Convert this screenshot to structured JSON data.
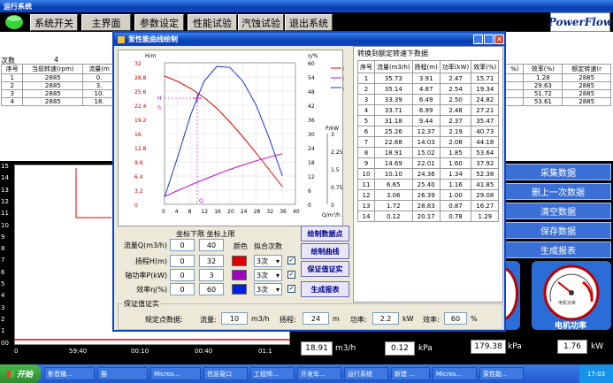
{
  "app": {
    "title": "运行系统",
    "logo": "PowerFlow"
  },
  "menu": [
    "系统开关",
    "主界面",
    "参数设定",
    "性能试验",
    "汽蚀试验",
    "退出系统"
  ],
  "bg_table": {
    "count_label": "次数",
    "count_value": "4",
    "headers": [
      "序号",
      "当前转速(rpm)",
      "流量(m"
    ],
    "rows": [
      [
        "1",
        "2885",
        "0."
      ],
      [
        "2",
        "2885",
        "3."
      ],
      [
        "3",
        "2885",
        "10."
      ],
      [
        "4",
        "2885",
        "18."
      ]
    ]
  },
  "right_table": {
    "top_label": "采集数据",
    "headers": [
      "%)",
      "效率(%)",
      "额定转速(r"
    ],
    "rows": [
      [
        "",
        "1.28",
        "2885"
      ],
      [
        "",
        "29.63",
        "2885"
      ],
      [
        "",
        "51.72",
        "2885"
      ],
      [
        "",
        "53.61",
        "2885"
      ]
    ]
  },
  "right_buttons": [
    "采集数据",
    "删上一次数据",
    "清空数据",
    "保存数据",
    "生成报表"
  ],
  "timeline": {
    "yticks": [
      "15",
      "14",
      "13",
      "12",
      "11",
      "10",
      "9",
      "8",
      "7",
      "6",
      "5",
      "4",
      "3",
      "2",
      "1",
      "00"
    ],
    "xticks": [
      "0",
      "59:40",
      "00:10",
      "00:40",
      "01:1"
    ]
  },
  "gauges": {
    "right_label": "电机功率",
    "right_sub": "电机功率"
  },
  "bottom_readouts": [
    {
      "value": "18.91",
      "unit": "m3/h"
    },
    {
      "value": "0.12",
      "unit": "kPa"
    },
    {
      "value": "179.38",
      "unit": "kPa"
    },
    {
      "value": "1.76",
      "unit": "kW"
    }
  ],
  "dialog": {
    "title": "泵性能曲线绘制",
    "axes": {
      "left_label": "H/m",
      "left_ticks": [
        "32",
        "28.8",
        "25.6",
        "22.4",
        "19.2",
        "16",
        "12.8",
        "9.6",
        "6.4",
        "3.2",
        "0"
      ],
      "mid_label": "η/%",
      "mid_ticks": [
        "60",
        "54",
        "48",
        "42",
        "36",
        "30",
        "24",
        "18",
        "12",
        "6",
        "0"
      ],
      "right_label": "P/kW",
      "right_ticks": [
        "3",
        "2.25",
        "1.5",
        "0.75",
        "0"
      ],
      "x_ticks": [
        "0",
        "4",
        "8",
        "12",
        "16",
        "20",
        "24",
        "28",
        "32",
        "36",
        "40"
      ],
      "x_label": "Q/m³/h",
      "h_marker": "H",
      "eta_marker": "η",
      "q_marker": "Q"
    },
    "legend": [
      "H-Q",
      "P-Q",
      "η-Q"
    ],
    "table_title": "转换到额定转速下数据",
    "table_headers": [
      "序号",
      "流量(m3/h)",
      "扬程(m)",
      "功率(kW)",
      "效率(%)"
    ],
    "table_rows": [
      [
        "1",
        "35.73",
        "3.91",
        "2.47",
        "15.71"
      ],
      [
        "2",
        "35.14",
        "4.87",
        "2.54",
        "19.34"
      ],
      [
        "3",
        "33.39",
        "6.49",
        "2.50",
        "24.82"
      ],
      [
        "4",
        "33.71",
        "6.99",
        "2.48",
        "27.21"
      ],
      [
        "5",
        "31.18",
        "9.44",
        "2.37",
        "35.47"
      ],
      [
        "6",
        "25.26",
        "12.37",
        "2.19",
        "40.73"
      ],
      [
        "7",
        "22.68",
        "14.03",
        "2.08",
        "44.18"
      ],
      [
        "8",
        "18.91",
        "15.02",
        "1.85",
        "53.64"
      ],
      [
        "9",
        "14.69",
        "22.01",
        "1.60",
        "37.92"
      ],
      [
        "10",
        "10.10",
        "24.36",
        "1.34",
        "52.38"
      ],
      [
        "11",
        "6.65",
        "25.40",
        "1.16",
        "41.85"
      ],
      [
        "12",
        "3.06",
        "26.39",
        "1.00",
        "29.08"
      ],
      [
        "13",
        "1.72",
        "28.83",
        "0.87",
        "16.27"
      ],
      [
        "14",
        "0.12",
        "20.17",
        "0.78",
        "1.29"
      ]
    ],
    "settings": {
      "header": "坐标下限 坐标上限",
      "rows": [
        {
          "label": "流量Q(m3/h)",
          "low": "0",
          "high": "40"
        },
        {
          "label": "扬程H(m)",
          "low": "0",
          "high": "32",
          "color": "#e00000",
          "fit": "3次"
        },
        {
          "label": "轴功率P(kW)",
          "low": "0",
          "high": "3",
          "color": "#a000c0",
          "fit": "3次"
        },
        {
          "label": "效率η(%)",
          "low": "0",
          "high": "60",
          "color": "#0020e0",
          "fit": "3次"
        }
      ],
      "color_label": "颜色",
      "fit_label": "拟合次数"
    },
    "actions": [
      "绘制数据点",
      "绘制曲线",
      "保证值证实",
      "生成报表"
    ],
    "guarantee": {
      "group": "保证值证实",
      "label": "规定点数据:",
      "flow_label": "流量:",
      "flow": "10",
      "flow_unit": "m3/h",
      "head_label": "扬程:",
      "head": "24",
      "head_unit": "m",
      "power_label": "功率:",
      "power": "2.2",
      "power_unit": "kW",
      "eff_label": "效率:",
      "eff": "60",
      "eff_unit": "%"
    }
  },
  "chart_data": {
    "type": "line",
    "title": "",
    "xlabel": "Q/m³/h",
    "xlim": [
      0,
      40
    ],
    "series": [
      {
        "name": "H-Q",
        "axis": "H",
        "ylim": [
          0,
          32
        ],
        "color": "#e00000",
        "x": [
          0,
          4,
          8,
          12,
          16,
          20,
          24,
          28,
          32,
          36
        ],
        "values": [
          29,
          27.8,
          26.2,
          24.2,
          21.7,
          18.6,
          15.2,
          11.6,
          7.8,
          4.0
        ]
      },
      {
        "name": "P-Q",
        "axis": "P",
        "ylim": [
          0,
          3
        ],
        "color": "#d000d0",
        "x": [
          0,
          4,
          8,
          12,
          16,
          20,
          24,
          28,
          32,
          36
        ],
        "values": [
          0.33,
          0.58,
          0.82,
          1.05,
          1.27,
          1.48,
          1.67,
          1.85,
          2.0,
          2.15
        ]
      },
      {
        "name": "η-Q",
        "axis": "eta",
        "ylim": [
          0,
          60
        ],
        "color": "#2030e0",
        "x": [
          0,
          4,
          8,
          12,
          16,
          20,
          24,
          28,
          32,
          36
        ],
        "values": [
          3,
          20,
          38,
          52,
          58.5,
          58,
          52,
          42,
          28,
          12
        ]
      }
    ]
  },
  "taskbar": {
    "start": "开始",
    "items": [
      "影音播...",
      "猫",
      "Micros...",
      "信息窗口",
      "工程师...",
      "开发车...",
      "运行系统",
      "新建 ...",
      "Micros...",
      "泵性能..."
    ],
    "time": "17:03"
  }
}
